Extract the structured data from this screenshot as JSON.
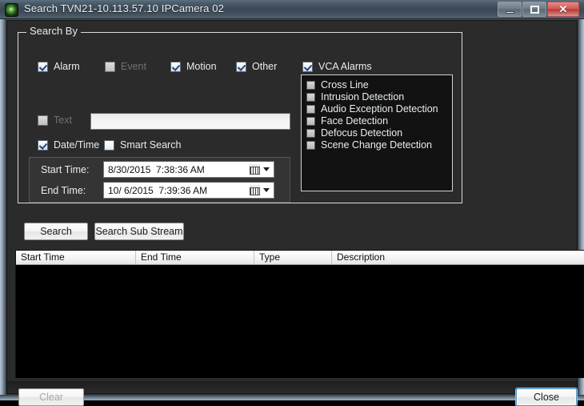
{
  "window": {
    "title": "Search  TVN21-10.113.57.10  IPCamera 02",
    "icon": "camera-icon",
    "controls": {
      "minimize": "minimize-icon",
      "maximize": "maximize-icon",
      "close": "✕"
    }
  },
  "search_by": {
    "legend": "Search By",
    "checkboxes": [
      {
        "label": "Alarm",
        "checked": true,
        "enabled": true
      },
      {
        "label": "Event",
        "checked": false,
        "enabled": false
      },
      {
        "label": "Motion",
        "checked": true,
        "enabled": true
      },
      {
        "label": "Other",
        "checked": true,
        "enabled": true
      },
      {
        "label": "VCA Alarms",
        "checked": true,
        "enabled": true
      }
    ],
    "text_row": {
      "label": "Text",
      "checked": false,
      "enabled": false,
      "value": "",
      "placeholder": ""
    },
    "datetime_row": {
      "label": "Date/Time",
      "checked": true
    },
    "smart_search": {
      "label": "Smart Search",
      "checked": false
    },
    "start_time": {
      "label": "Start Time:",
      "value": "8/30/2015  7:38:36 AM"
    },
    "end_time": {
      "label": "End Time:",
      "value": "10/ 6/2015  7:39:36 AM"
    }
  },
  "vca_list": [
    {
      "label": "Cross Line",
      "checked": false
    },
    {
      "label": "Intrusion Detection",
      "checked": false
    },
    {
      "label": "Audio Exception Detection",
      "checked": false
    },
    {
      "label": "Face Detection",
      "checked": false
    },
    {
      "label": "Defocus Detection",
      "checked": false
    },
    {
      "label": "Scene Change Detection",
      "checked": false
    }
  ],
  "buttons": {
    "search": "Search",
    "search_sub_stream": "Search Sub Stream",
    "clear": "Clear",
    "close": "Close"
  },
  "results": {
    "columns": [
      "Start Time",
      "End Time",
      "Type",
      "Description"
    ],
    "rows": []
  },
  "colors": {
    "window_background": "#2b2b2b",
    "titlebar": "#3a4854",
    "text": "#e8ecef",
    "disabled_text": "#717171",
    "list_background": "#000000",
    "close_button": "#cf5a56",
    "focus_border": "#4a93c9"
  }
}
